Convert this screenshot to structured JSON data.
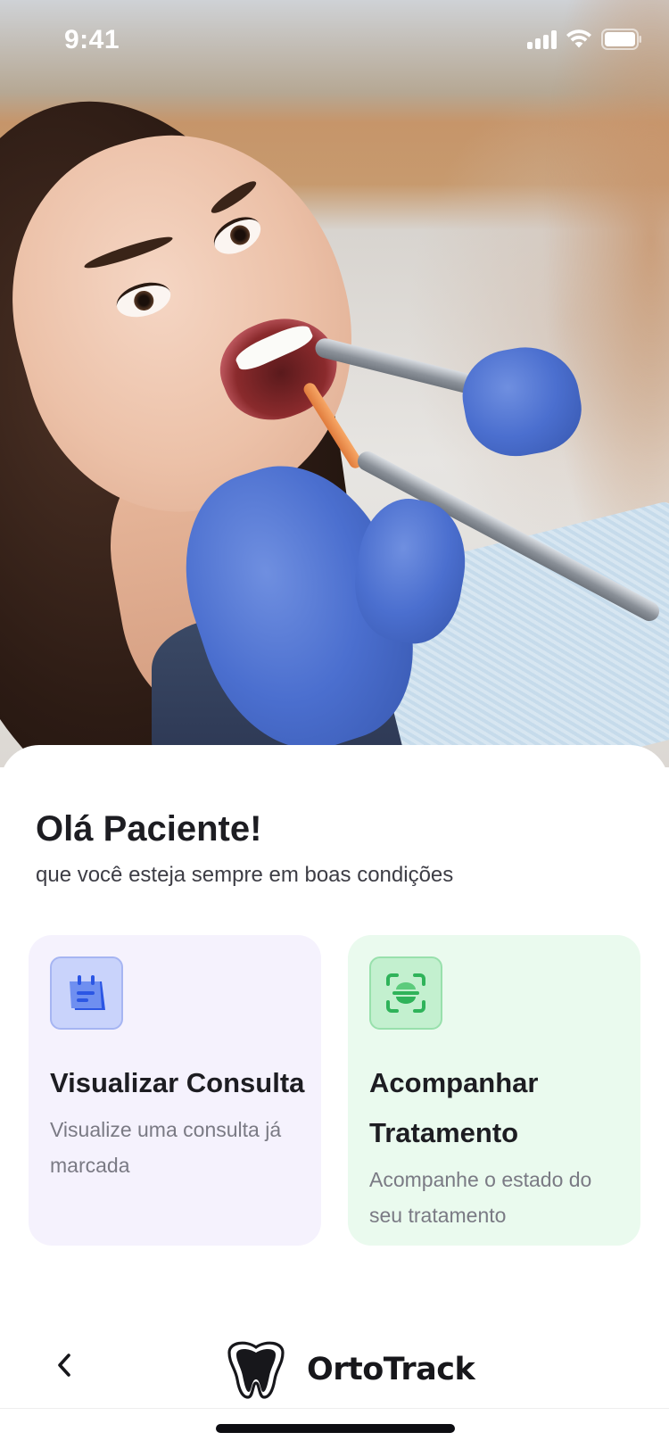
{
  "status_bar": {
    "time": "9:41",
    "icons": [
      "signal-icon",
      "wifi-icon",
      "battery-icon"
    ]
  },
  "hero": {
    "image": "patient-at-dentist-photo"
  },
  "greeting": {
    "title": "Olá Paciente!",
    "subtitle": "que você esteja sempre em boas condições"
  },
  "cards": [
    {
      "title": "Visualizar Consulta",
      "description": "Visualize uma consulta já marcada",
      "icon": "calendar-icon",
      "background": "#f5f2fd",
      "accent": "#3a5fe6"
    },
    {
      "title": "Acompanhar Tratamento",
      "description": "Acompanhe o estado do seu tratamento",
      "icon": "scan-tooth-icon",
      "background": "#eafaee",
      "accent": "#2fb35a"
    }
  ],
  "nav": {
    "back_icon": "chevron-left-icon",
    "brand_name": "OrtoTrack",
    "brand_logo": "tooth-logo"
  }
}
